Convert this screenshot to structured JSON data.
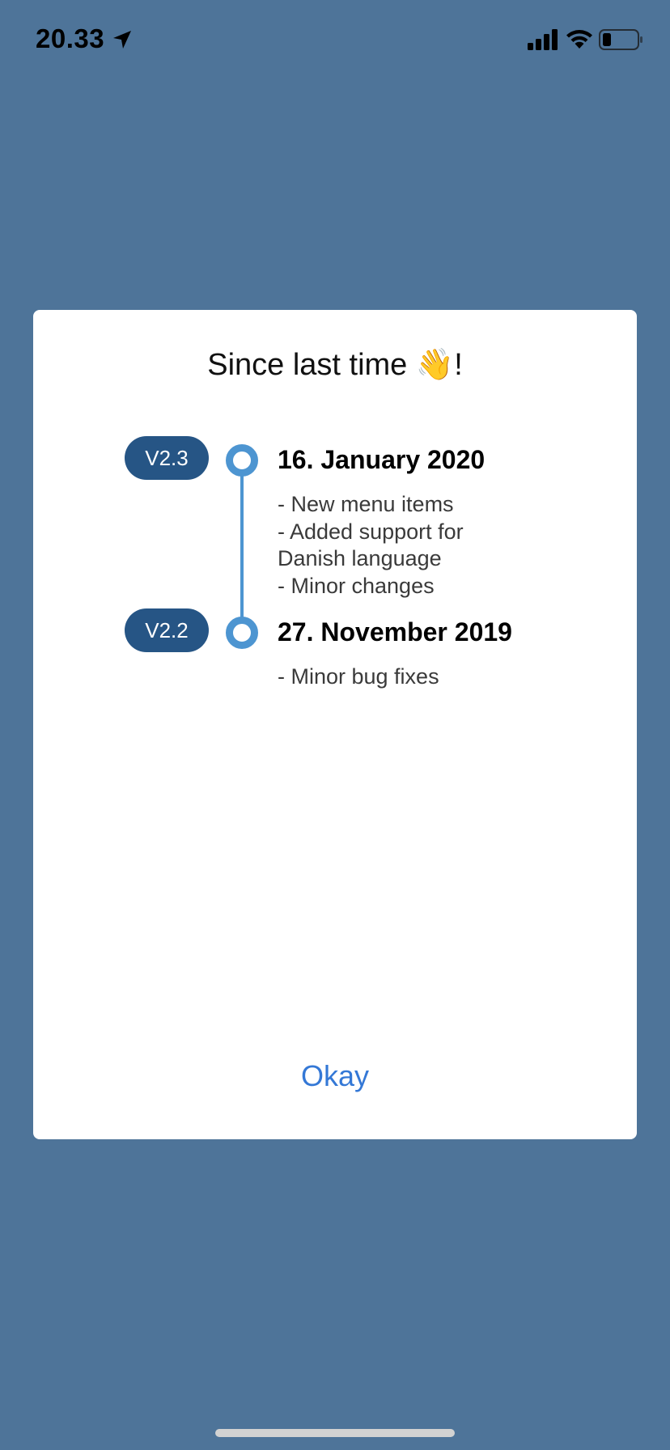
{
  "status_bar": {
    "time": "20.33",
    "location_icon": "location-arrow-icon",
    "signal_icon": "cellular-signal-icon",
    "wifi_icon": "wifi-icon",
    "battery_icon": "battery-icon",
    "battery_level": 0.2
  },
  "modal": {
    "title": "Since last time",
    "title_emoji": "👋",
    "title_suffix": "!",
    "entries": [
      {
        "version": "V2.3",
        "date": "16. January 2020",
        "notes": [
          "- New menu items",
          "- Added support for Danish language",
          "- Minor changes"
        ]
      },
      {
        "version": "V2.2",
        "date": "27. November 2019",
        "notes": [
          "- Minor bug fixes"
        ]
      }
    ],
    "okay_label": "Okay"
  },
  "colors": {
    "background": "#4e7499",
    "badge": "#265585",
    "timeline": "#4d95d1",
    "button_text": "#3478d6"
  }
}
